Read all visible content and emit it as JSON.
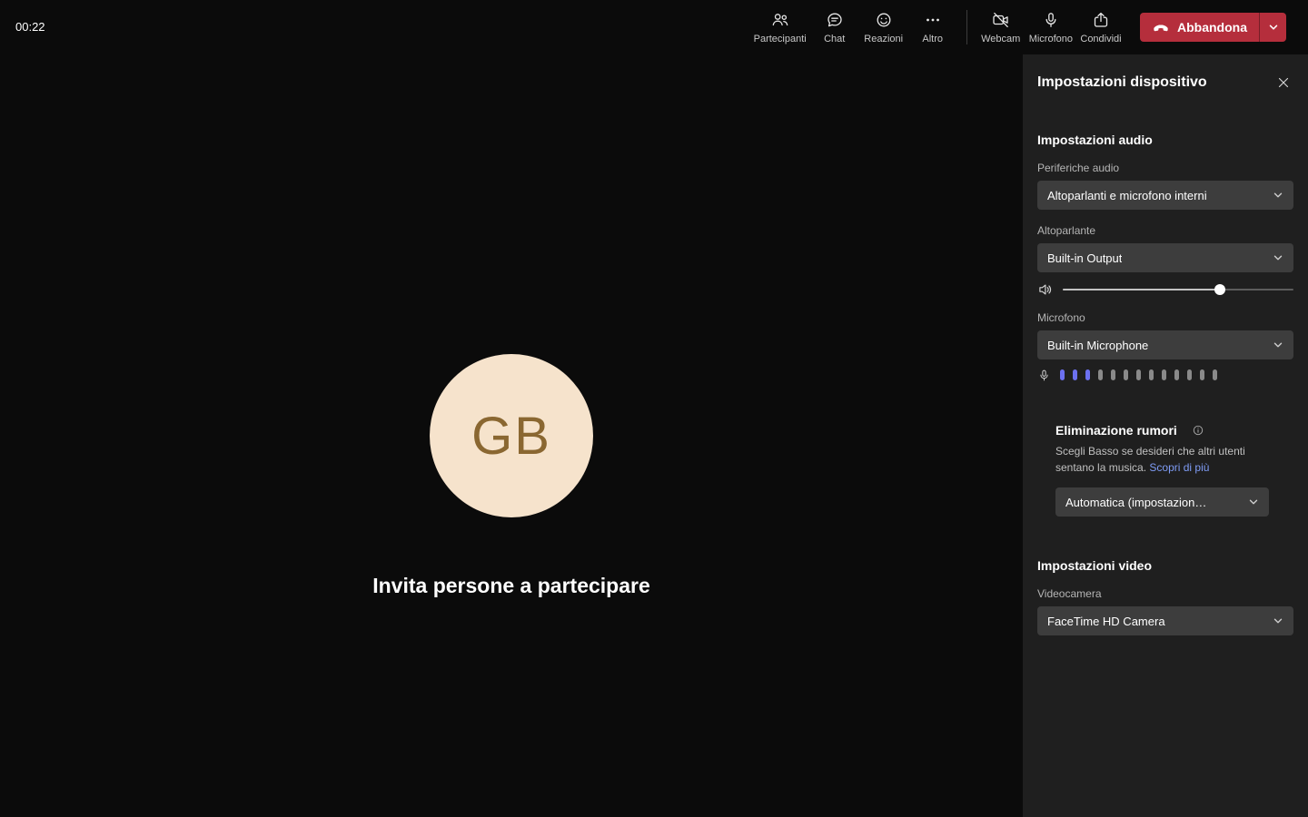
{
  "colors": {
    "page_bg": "#0b0b0b",
    "panel_bg": "#1f1f1f",
    "field_bg": "#3d3d3d",
    "accent": "#6c70f0",
    "leave_red": "#b52e3c",
    "avatar_bg": "#f6e3cc",
    "avatar_text": "#8a6731",
    "link": "#7f9cf5"
  },
  "topbar": {
    "timer": "00:22",
    "buttons": [
      {
        "label": "Partecipanti",
        "icon": "people-icon"
      },
      {
        "label": "Chat",
        "icon": "chat-icon"
      },
      {
        "label": "Reazioni",
        "icon": "reaction-icon"
      },
      {
        "label": "Altro",
        "icon": "ellipsis-icon"
      },
      {
        "label": "Webcam",
        "icon": "camera-off-icon"
      },
      {
        "label": "Microfono",
        "icon": "microphone-icon"
      },
      {
        "label": "Condividi",
        "icon": "share-icon"
      }
    ],
    "leave_label": "Abbandona"
  },
  "stage": {
    "avatar_initials": "GB",
    "invite_text": "Invita persone a partecipare"
  },
  "panel": {
    "title": "Impostazioni dispositivo",
    "audio": {
      "section_title": "Impostazioni audio",
      "devices_label": "Periferiche audio",
      "devices_value": "Altoparlanti e microfono interni",
      "speaker_label": "Altoparlante",
      "speaker_value": "Built-in Output",
      "volume_percent": 68,
      "mic_label": "Microfono",
      "mic_value": "Built-in Microphone",
      "meter": {
        "total": 13,
        "active": 3
      },
      "noise": {
        "title": "Eliminazione rumori",
        "description": "Scegli Basso se desideri che altri utenti sentano la musica.",
        "link_label": "Scopri di più",
        "value": "Automatica (impostazion…"
      }
    },
    "video": {
      "section_title": "Impostazioni video",
      "camera_label": "Videocamera",
      "camera_value": "FaceTime HD Camera"
    }
  }
}
